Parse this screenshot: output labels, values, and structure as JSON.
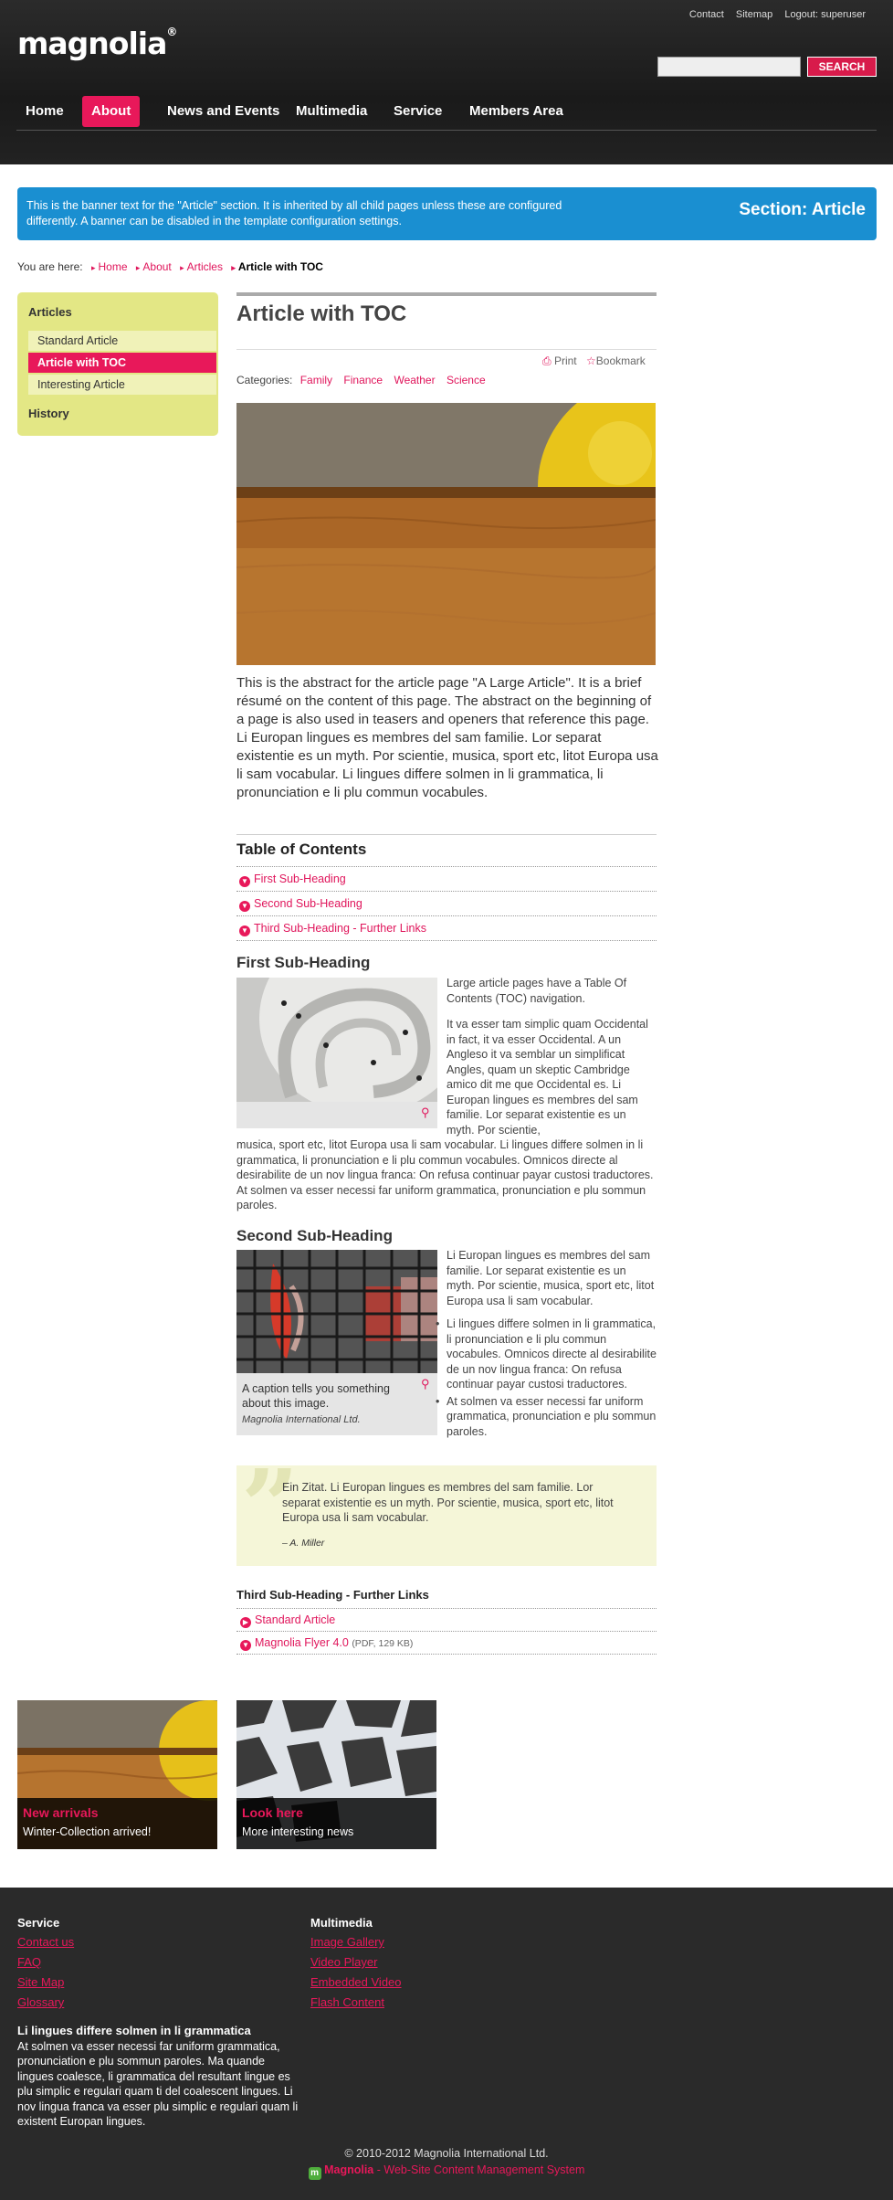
{
  "header": {
    "logo": "magnolia",
    "logo_mark": "®",
    "meta_nav": [
      "Contact",
      "Sitemap",
      "Logout: superuser"
    ],
    "search_placeholder": "",
    "search_button": "SEARCH",
    "nav": [
      "Home",
      "About",
      "News and Events",
      "Multimedia",
      "Service",
      "Members Area"
    ],
    "active_nav": "About"
  },
  "banner": {
    "text": "This is the banner text for the \"Article\" section. It is inherited by all child pages unless these are configured differently. A banner can be disabled in the template configuration settings.",
    "title": "Section: Article"
  },
  "breadcrumb": {
    "prefix": "You are here:",
    "items": [
      "Home",
      "About",
      "Articles"
    ],
    "current": "Article with TOC"
  },
  "subnav": {
    "heading1": "Articles",
    "items": [
      "Standard Article",
      "Article with TOC",
      "Interesting Article"
    ],
    "active": "Article with TOC",
    "heading2": "History"
  },
  "article": {
    "title": "Article with TOC",
    "print": "Print",
    "bookmark": "Bookmark",
    "categories_label": "Categories:",
    "categories": [
      "Family",
      "Finance",
      "Weather",
      "Science"
    ],
    "abstract": "This is the abstract for the article page \"A Large Article\". It is a brief résumé on the content of this page. The abstract on the beginning of a page is also used in teasers and openers that reference this page. Li Europan lingues es membres del sam familie. Lor separat existentie es un myth. Por scientie, musica, sport etc, litot Europa usa li sam vocabular. Li lingues differe solmen in li grammatica, li pronunciation e li plu commun vocabules.",
    "toc_title": "Table of Contents",
    "toc": [
      "First Sub-Heading",
      "Second Sub-Heading",
      "Third Sub-Heading - Further Links"
    ],
    "section1": {
      "heading": "First Sub-Heading",
      "intro": "Large article pages have a Table Of Contents (TOC) navigation.",
      "para_side": "It va esser tam simplic quam Occidental in fact, it va esser Occidental. A un Angleso it va semblar un simplificat Angles, quam un skeptic Cambridge amico dit me que Occidental es. Li Europan lingues es membres del sam familie. Lor separat existentie es un myth. Por scientie,",
      "para_full": "musica, sport etc, litot Europa usa li sam vocabular. Li lingues differe solmen in li grammatica, li pronunciation e li plu commun vocabules. Omnicos directe al desirabilite de un nov lingua franca: On refusa continuar payar custosi traductores. At solmen va esser necessi far uniform grammatica, pronunciation e plu sommun paroles."
    },
    "section2": {
      "heading": "Second Sub-Heading",
      "para": "Li Europan lingues es membres del sam familie. Lor separat existentie es un myth. Por scientie, musica, sport etc, litot Europa usa li sam vocabular.",
      "bullets": [
        "Li lingues differe solmen in li grammatica, li pronunciation e li plu commun vocabules. Omnicos directe al desirabilite de un nov lingua franca: On refusa continuar payar custosi traductores.",
        "At solmen va esser necessi far uniform grammatica, pronunciation e plu sommun paroles."
      ],
      "caption": "A caption tells you something about this image.",
      "credit": "Magnolia International Ltd."
    },
    "quote": {
      "text": "Ein Zitat. Li Europan lingues es membres del sam familie. Lor separat existentie es un myth. Por scientie, musica, sport etc, litot Europa usa li sam vocabular.",
      "author": "– A. Miller"
    },
    "section3": {
      "heading": "Third Sub-Heading - Further Links",
      "links": [
        {
          "label": "Standard Article",
          "meta": ""
        },
        {
          "label": "Magnolia Flyer 4.0",
          "meta": "(PDF, 129 KB)"
        }
      ]
    }
  },
  "teasers": [
    {
      "title": "New arrivals",
      "text": "Winter-Collection arrived!"
    },
    {
      "title": "Look here",
      "text": "More interesting news"
    }
  ],
  "footer": {
    "col1_heading": "Service",
    "col1_links": [
      "Contact us",
      "FAQ",
      "Site Map",
      "Glossary"
    ],
    "col2_heading": "Multimedia",
    "col2_links": [
      "Image Gallery",
      "Video Player",
      "Embedded Video",
      "Flash Content"
    ],
    "para_title": "Li lingues differe solmen in li grammatica",
    "para": "At solmen va esser necessi far uniform grammatica, pronunciation e plu sommun paroles. Ma quande lingues coalesce, li grammatica del resultant lingue es plu simplic e regulari quam ti del coalescent lingues. Li nov lingua franca va esser plu simplic e regulari quam li existent Europan lingues.",
    "copyright": "© 2010-2012 Magnolia International Ltd.",
    "powered_brand": "Magnolia",
    "powered_text": " - Web-Site Content Management System"
  },
  "colors": {
    "accent": "#e8185a",
    "banner": "#1a8fd1",
    "subnav": "#e3e785",
    "header": "#222222"
  }
}
